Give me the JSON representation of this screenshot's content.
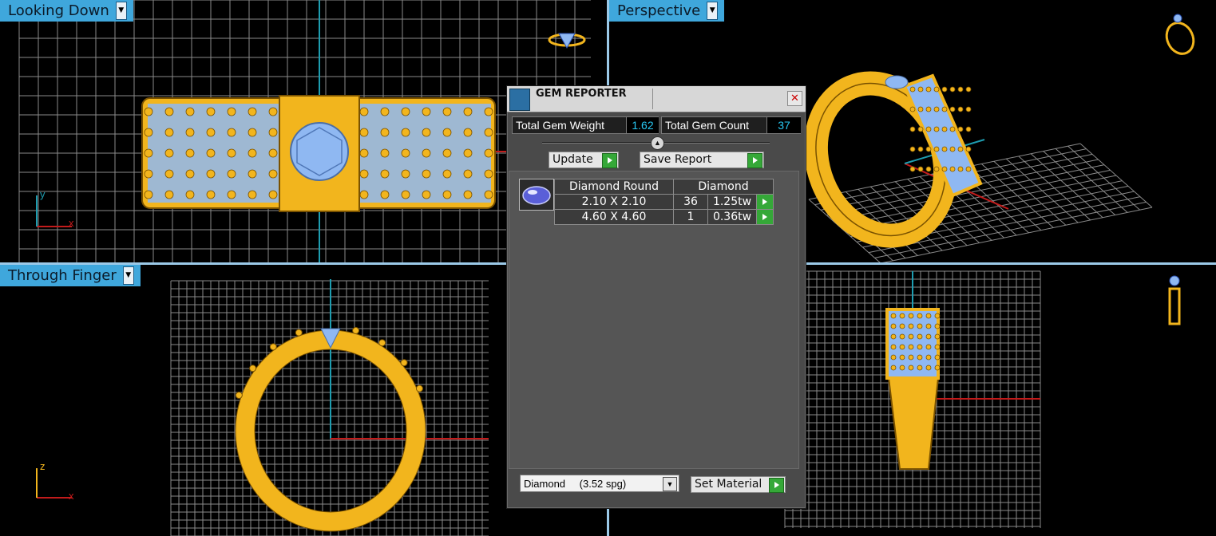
{
  "viewports": {
    "top_left": {
      "label": "Looking Down",
      "axis_a": "y",
      "axis_b": "x"
    },
    "top_right": {
      "label": "Perspective"
    },
    "bottom_left": {
      "label": "Through Finger",
      "axis_a": "z",
      "axis_b": "x"
    },
    "bottom_right": {
      "label": ""
    }
  },
  "gem_reporter": {
    "title": "GEM REPORTER",
    "close_glyph": "✕",
    "total_gem_weight_label": "Total Gem Weight",
    "total_gem_weight_value": "1.62",
    "total_gem_count_label": "Total Gem Count",
    "total_gem_count_value": "37",
    "update_label": "Update",
    "save_report_label": "Save Report",
    "table": {
      "headers": [
        "Diamond Round",
        "Diamond"
      ],
      "rows": [
        {
          "size": "2.10 X 2.10",
          "count": "36",
          "weight": "1.25tw"
        },
        {
          "size": "4.60 X 4.60",
          "count": "1",
          "weight": "0.36tw"
        }
      ]
    },
    "material_select": {
      "name": "Diamond",
      "density": "(3.52 spg)"
    },
    "set_material_label": "Set Material"
  },
  "colors": {
    "gold": "#f2b51d",
    "gem_blue": "#8fb8f2",
    "axis_red": "#c21b1b",
    "axis_cyan": "#1e9db0",
    "label_blue": "#3fa7dc",
    "count_cyan": "#27c7f2"
  }
}
